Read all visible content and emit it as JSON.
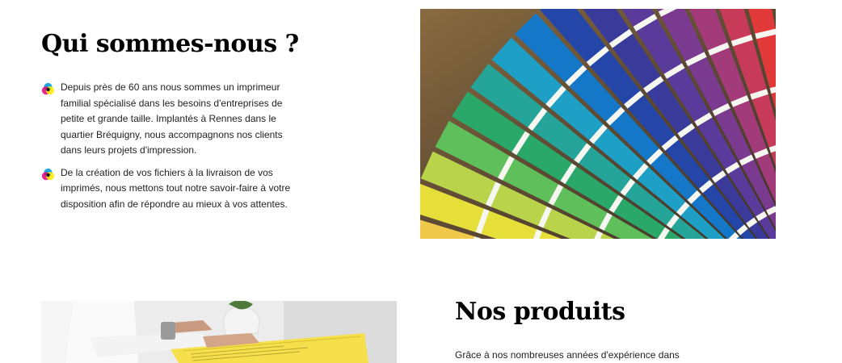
{
  "about": {
    "title": "Qui sommes-nous ?",
    "paragraphs": [
      "Depuis près de 60 ans nous sommes un imprimeur familial spécialisé dans les besoins d'entreprises de petite et grande taille. Implantés à Rennes dans le quartier Bréquigny, nous accompagnons nos clients dans leurs projets d'impression.",
      "De la création de vos fichiers à la livraison de vos imprimés, nous mettons tout notre savoir-faire à votre disposition afin de répondre au mieux à vos attentes."
    ],
    "bullet_icon": "cmy-circles-icon",
    "image": "color-swatch-fan-photo"
  },
  "products": {
    "title": "Nos produits",
    "intro": "Grâce à nos nombreuses années d'expérience dans",
    "image": "printed-sheet-photo"
  },
  "colors": {
    "cyan": "#00a0e3",
    "magenta": "#e6007e",
    "yellow": "#ffed00",
    "text": "#222222",
    "heading": "#000000"
  }
}
